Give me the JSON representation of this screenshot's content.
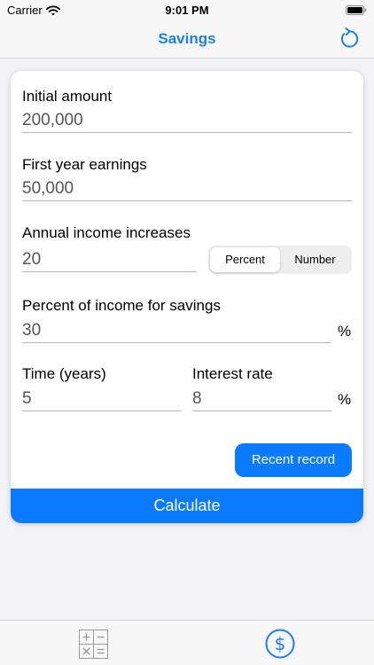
{
  "status_bar": {
    "carrier": "Carrier",
    "time": "9:01 PM"
  },
  "nav": {
    "title": "Savings",
    "refresh_icon": "refresh-icon"
  },
  "form": {
    "initial_amount": {
      "label": "Initial amount",
      "value": "200,000"
    },
    "first_year_earnings": {
      "label": "First year earnings",
      "value": "50,000"
    },
    "annual_income_increases": {
      "label": "Annual income increases",
      "value": "20",
      "options": [
        "Percent",
        "Number"
      ],
      "selected": "Percent"
    },
    "savings_percent": {
      "label": "Percent of income for savings",
      "value": "30",
      "unit": "%"
    },
    "time_years": {
      "label": "Time (years)",
      "value": "5"
    },
    "interest_rate": {
      "label": "Interest rate",
      "value": "8",
      "unit": "%"
    }
  },
  "buttons": {
    "recent_record": "Recent record",
    "calculate": "Calculate"
  },
  "tabs": [
    {
      "name": "calculator",
      "icon": "calculator-icon",
      "active": false
    },
    {
      "name": "savings",
      "icon": "dollar-circle-icon",
      "active": true
    }
  ],
  "colors": {
    "accent": "#0a7bff",
    "nav_title": "#1a7ff2",
    "inactive_icon": "#9a9a9a"
  }
}
